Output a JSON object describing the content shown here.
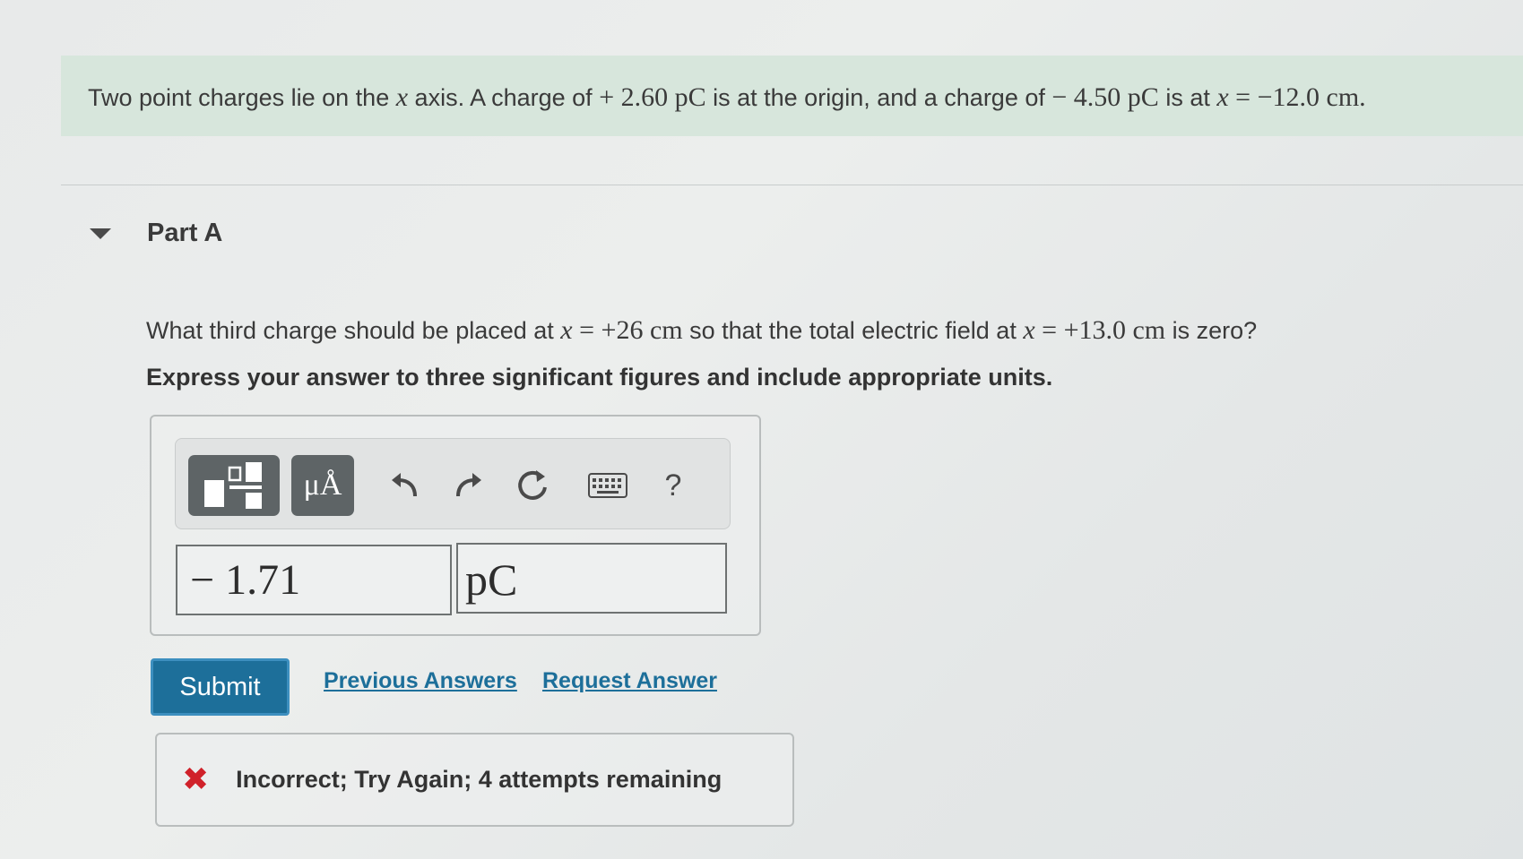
{
  "problem": {
    "p1": "Two point charges lie on the ",
    "x1": "x",
    "p2": " axis. A charge of ",
    "charge1": "+ 2.60 pC",
    "p3": " is at the origin, and a charge of ",
    "charge2": "− 4.50 pC",
    "p4": " is at ",
    "x2": "x",
    "pos2": " = −12.0 cm",
    "p5": "."
  },
  "part": {
    "title": "Part A"
  },
  "question": {
    "q1": "What third charge should be placed at ",
    "x1": "x",
    "pos1": " = +26 cm",
    "q2": " so that the total electric field at ",
    "x2": "x",
    "pos2": " = +13.0 cm",
    "q3": " is zero?"
  },
  "instruction": "Express your answer to three significant figures and include appropriate units.",
  "toolbar": {
    "templates_icon": "templates-icon",
    "units_label": "μÅ",
    "undo_icon": "undo-icon",
    "redo_icon": "redo-icon",
    "reset_icon": "reset-icon",
    "keyboard_icon": "keyboard-icon",
    "help_label": "?"
  },
  "answer": {
    "value": "− 1.71",
    "unit": "pC"
  },
  "actions": {
    "submit_label": "Submit",
    "previous_answers": "Previous Answers",
    "request_answer": "Request Answer"
  },
  "feedback": {
    "icon": "incorrect-x-icon",
    "text": "Incorrect; Try Again; 4 attempts remaining"
  },
  "colors": {
    "banner": "#d7e6dc",
    "primary": "#1d6f9a",
    "error": "#d0212a"
  }
}
